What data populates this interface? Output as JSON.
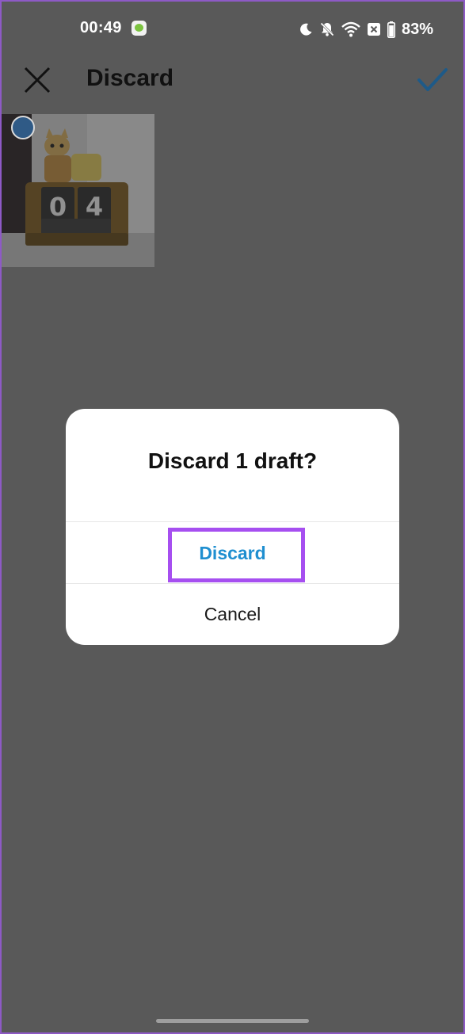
{
  "status_bar": {
    "time": "00:49",
    "battery_percent": "83%",
    "icons": [
      "messages-app-icon",
      "moon-icon",
      "mute-bell-icon",
      "wifi-icon",
      "no-sim-icon",
      "battery-icon"
    ]
  },
  "header": {
    "title": "Discard",
    "close_icon": "close-icon",
    "confirm_icon": "check-icon"
  },
  "drafts": {
    "items": [
      {
        "selected": true,
        "thumbnail_icon": "desk-calendar-photo"
      }
    ]
  },
  "dialog": {
    "title": "Discard 1 draft?",
    "discard_label": "Discard",
    "cancel_label": "Cancel"
  },
  "colors": {
    "overlay_background": "#595959",
    "accent_blue": "#1f8fd0",
    "highlight_purple": "#a64ff0",
    "dialog_background": "#ffffff"
  }
}
